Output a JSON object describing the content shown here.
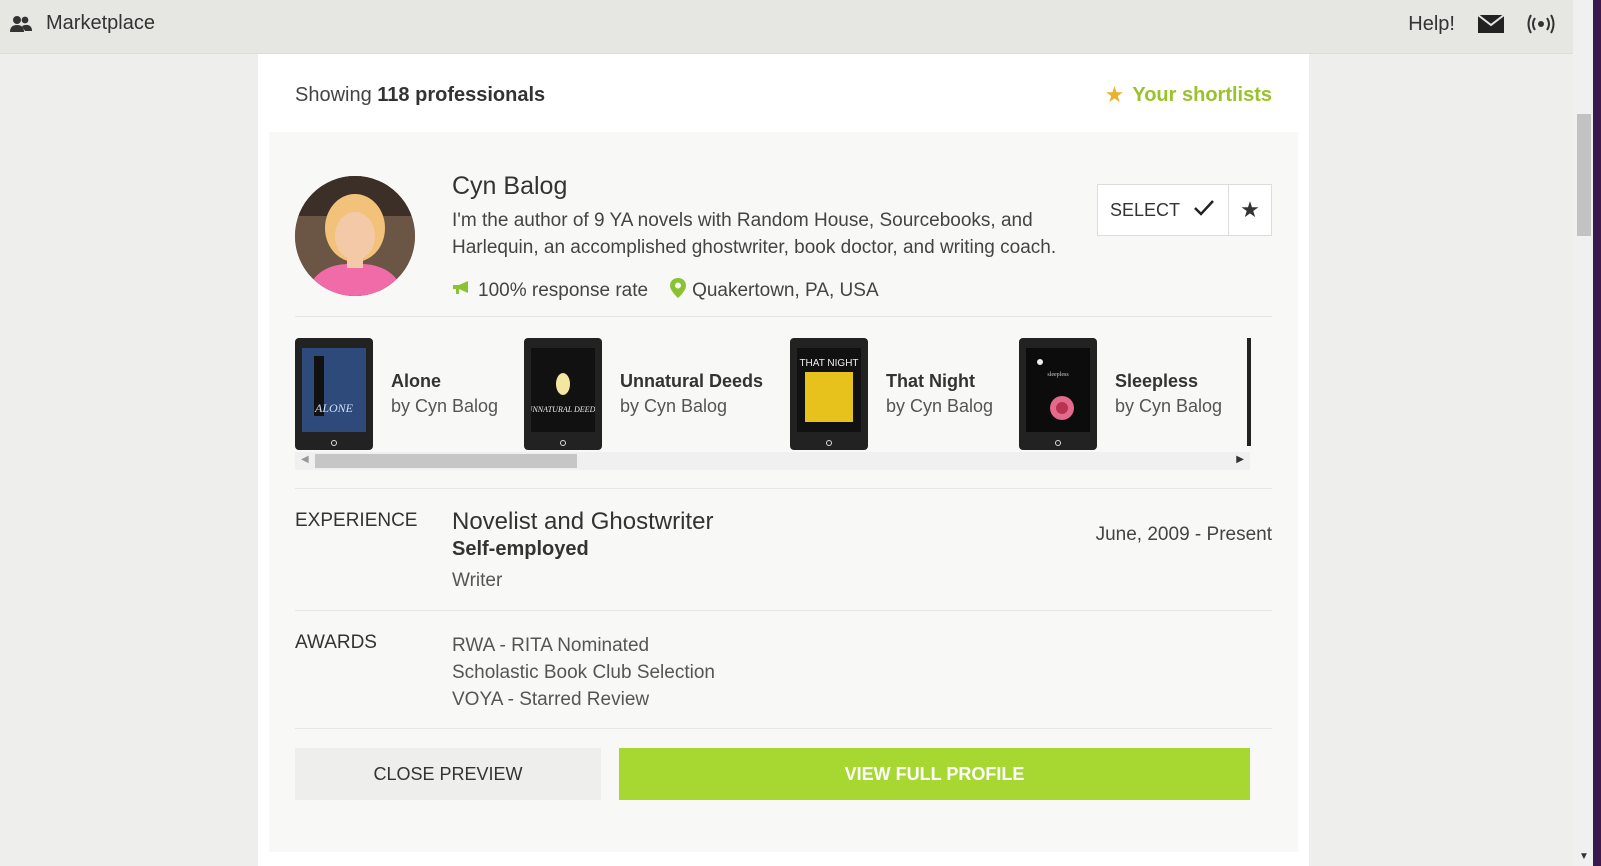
{
  "topbar": {
    "brand_icon": "people-icon",
    "brand_label": "Marketplace",
    "help_label": "Help!",
    "mail_icon": "envelope-icon",
    "broadcast_icon": "broadcast-icon"
  },
  "results": {
    "showing_prefix": "Showing",
    "showing_count": "118 professionals",
    "shortlists_label": "Your shortlists"
  },
  "profile": {
    "name": "Cyn Balog",
    "bio": "I'm the author of 9 YA novels with Random House, Sourcebooks, and Harlequin, an accomplished ghostwriter, book doctor, and writing coach.",
    "response_rate": "100% response rate",
    "location": "Quakertown, PA, USA",
    "select_label": "SELECT"
  },
  "books": [
    {
      "title": "Alone",
      "author": "by Cyn Balog",
      "cover_text": "ALONE",
      "cover_color": "#2e4a7a"
    },
    {
      "title": "Unnatural Deeds",
      "author": "by Cyn Balog",
      "cover_text": "UNNATURAL DEEDS",
      "cover_color": "#111111"
    },
    {
      "title": "That Night",
      "author": "by Cyn Balog",
      "cover_text": "THAT NIGHT",
      "cover_color": "#e8c21c"
    },
    {
      "title": "Sleepless",
      "author": "by Cyn Balog",
      "cover_text": "sleepless",
      "cover_color": "#0c0c0c"
    }
  ],
  "experience": {
    "label": "EXPERIENCE",
    "title": "Novelist and Ghostwriter",
    "company": "Self-employed",
    "role": "Writer",
    "dates": "June, 2009 - Present"
  },
  "awards": {
    "label": "AWARDS",
    "items": [
      "RWA - RITA Nominated",
      "Scholastic Book Club Selection",
      "VOYA - Starred Review"
    ]
  },
  "actions": {
    "close_label": "CLOSE PREVIEW",
    "view_label": "VIEW FULL PROFILE"
  },
  "colors": {
    "accent_green": "#a7d831",
    "shortlist_green": "#9ac22a",
    "star_gold": "#e9b22a"
  }
}
